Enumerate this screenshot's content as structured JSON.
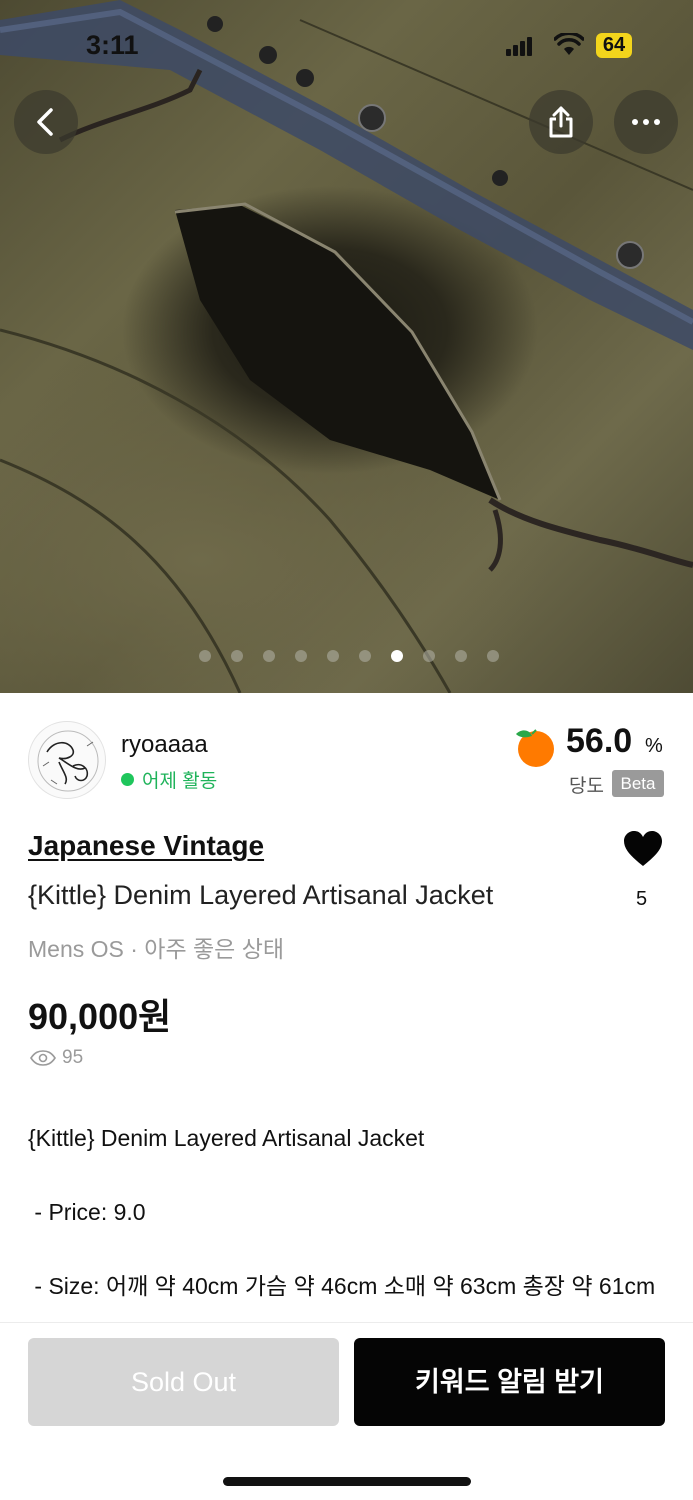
{
  "status_bar": {
    "time": "3:11",
    "battery": "64"
  },
  "gallery": {
    "total_images": 10,
    "current_index": 7
  },
  "seller": {
    "name": "ryoaaaa",
    "activity": "어제 활동",
    "rating_value": "56.0",
    "rating_unit": "%",
    "rating_label": "당도",
    "rating_badge": "Beta"
  },
  "product": {
    "brand": "Japanese Vintage",
    "title": "{Kittle} Denim Layered Artisanal Jacket",
    "meta": "Mens  OS · 아주 좋은 상태",
    "price": "90,000원",
    "views": "95",
    "likes": "5",
    "description": {
      "line1": "{Kittle} Denim Layered Artisanal Jacket",
      "line2": " - Price: 9.0",
      "line3": " - Size: 어깨 약 40cm 가슴 약 46cm 소매 약 63cm 총장 약 61cm"
    }
  },
  "actions": {
    "sold_out_label": "Sold Out",
    "keyword_alert_label": "키워드 알림 받기"
  },
  "colors": {
    "accent_green": "#1fc65c",
    "primary_button": "#050505",
    "disabled_button": "#d6d6d6",
    "rating_orange": "#ff7a00"
  }
}
